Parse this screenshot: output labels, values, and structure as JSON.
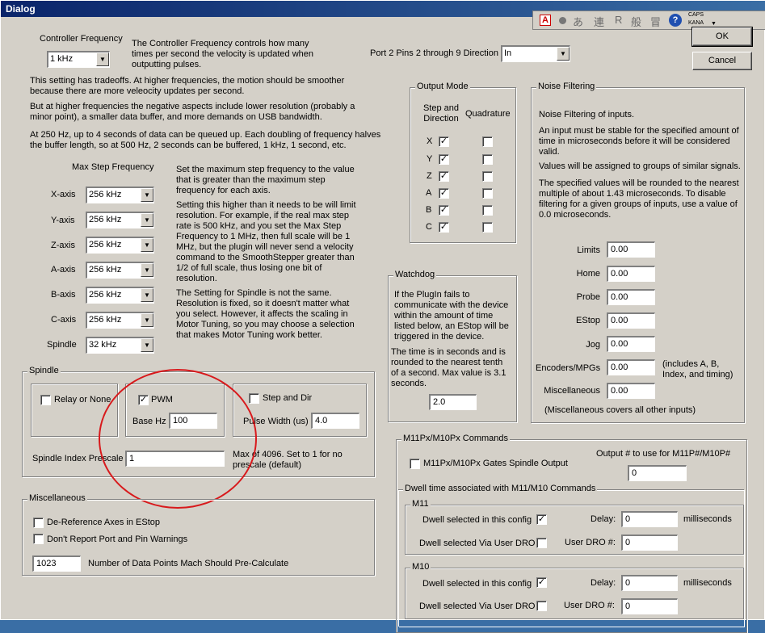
{
  "window": {
    "title": "Dialog"
  },
  "buttons": {
    "ok": "OK",
    "cancel": "Cancel"
  },
  "langbar": {
    "items": [
      "あ",
      "連",
      "R",
      "般",
      "冒"
    ],
    "caps": "CAPS",
    "kana": "KANA"
  },
  "controller": {
    "label": "Controller Frequency",
    "value": "1 kHz",
    "desc": "The Controller Frequency controls how many times per second the velocity is updated when outputting pulses.",
    "para1": "This setting has tradeoffs.  At higher frequencies, the motion should be smoother because there are more veleocity updates per second.",
    "para2": "But at higher frequencies the negative aspects include lower resolution (probably a minor point), a smaller data buffer, and more demands on USB bandwidth.",
    "para3": "At 250 Hz, up to 4 seconds of data can be queued up.  Each doubling of frequency halves the buffer length, so at 500 Hz, 2 seconds can be buffered, 1 kHz, 1 second, etc."
  },
  "port2": {
    "label": "Port 2 Pins 2 through 9 Direction",
    "value": "In"
  },
  "max_step": {
    "title": "Max Step Frequency",
    "axes": [
      {
        "label": "X-axis",
        "value": "256 kHz"
      },
      {
        "label": "Y-axis",
        "value": "256 kHz"
      },
      {
        "label": "Z-axis",
        "value": "256 kHz"
      },
      {
        "label": "A-axis",
        "value": "256 kHz"
      },
      {
        "label": "B-axis",
        "value": "256 kHz"
      },
      {
        "label": "C-axis",
        "value": "256 kHz"
      },
      {
        "label": "Spindle",
        "value": "32 kHz"
      }
    ],
    "desc1": "Set the maximum step frequency to the value that is greater than the maximum step frequency for each axis.",
    "desc2": "Setting this higher than it needs to be will limit resolution.  For example, if the real max step rate is 500 kHz, and you set the Max Step Frequency to 1 MHz, then full scale will be 1 MHz, but the plugin will never send a velocity command to the SmoothStepper greater than 1/2 of full scale, thus losing one bit of resolution.",
    "desc3": "The Setting for Spindle is not the same. Resolution is fixed, so it doesn't matter what you select.  However, it affects the scaling in Motor Tuning, so you may choose a selection that makes Motor Tuning work better."
  },
  "output_mode": {
    "title": "Output Mode",
    "col1": "Step and Direction",
    "col2": "Quadrature",
    "rows": [
      {
        "axis": "X",
        "step": true,
        "quad": false
      },
      {
        "axis": "Y",
        "step": true,
        "quad": false
      },
      {
        "axis": "Z",
        "step": true,
        "quad": false
      },
      {
        "axis": "A",
        "step": true,
        "quad": false
      },
      {
        "axis": "B",
        "step": true,
        "quad": false
      },
      {
        "axis": "C",
        "step": true,
        "quad": false
      }
    ]
  },
  "noise": {
    "title": "Noise Filtering",
    "p1": "Noise Filtering of inputs.",
    "p2": "An input must be stable for the specified amount of time in microseconds before it will be considered valid.",
    "p3": "Values will be assigned to groups of similar signals.",
    "p4": "The specified values will be rounded to the nearest multiple of about 1.43 microseconds.  To disable filtering for a given groups of inputs, use a value of 0.0 microseconds.",
    "fields": [
      {
        "label": "Limits",
        "value": "0.00"
      },
      {
        "label": "Home",
        "value": "0.00"
      },
      {
        "label": "Probe",
        "value": "0.00"
      },
      {
        "label": "EStop",
        "value": "0.00"
      },
      {
        "label": "Jog",
        "value": "0.00"
      },
      {
        "label": "Encoders/MPGs",
        "value": "0.00"
      },
      {
        "label": "Miscellaneous",
        "value": "0.00"
      }
    ],
    "encoders_note": "(includes A, B, Index, and timing)",
    "misc_note": "(Miscellaneous covers all other inputs)"
  },
  "watchdog": {
    "title": "Watchdog",
    "p1": "If the PlugIn fails to communicate with the device within the amount of time listed below, an EStop will be triggered in the device.",
    "p2": "The time is in seconds and is rounded to the nearest tenth of a second.  Max value is 3.1 seconds.",
    "value": "2.0"
  },
  "spindle": {
    "title": "Spindle",
    "relay_label": "Relay or None",
    "relay_checked": false,
    "pwm_label": "PWM",
    "pwm_checked": true,
    "base_hz_label": "Base Hz",
    "base_hz_value": "100",
    "stepdir_label": "Step and Dir",
    "stepdir_checked": false,
    "pulse_label": "Pulse Width (us)",
    "pulse_value": "4.0",
    "index_label": "Spindle Index Prescale",
    "index_value": "1",
    "index_note": "Max of 4096. Set to 1 for no prescale (default)"
  },
  "misc": {
    "title": "Miscellaneous",
    "deref_label": "De-Reference Axes in EStop",
    "noreport_label": "Don't Report Port and Pin Warnings",
    "points_value": "1023",
    "points_label": "Number of Data Points Mach Should Pre-Calculate"
  },
  "m11": {
    "title": "M11Px/M10Px Commands",
    "gates_label": "M11Px/M10Px Gates Spindle Output",
    "output_label": "Output # to use for M11P#/M10P#",
    "output_value": "0",
    "dwell_title": "Dwell time associated with M11/M10 Commands",
    "groups": [
      {
        "title": "M11",
        "dwell_label": "Dwell selected in this config",
        "dwell_checked": true,
        "delay_label": "Delay:",
        "delay_value": "0",
        "ms_label": "milliseconds",
        "userdro_label": "Dwell selected Via User DRO",
        "userdro_checked": false,
        "dro_label": "User DRO #:",
        "dro_value": "0"
      },
      {
        "title": "M10",
        "dwell_label": "Dwell selected in this config",
        "dwell_checked": true,
        "delay_label": "Delay:",
        "delay_value": "0",
        "ms_label": "milliseconds",
        "userdro_label": "Dwell selected Via User DRO",
        "userdro_checked": false,
        "dro_label": "User DRO #:",
        "dro_value": "0"
      }
    ]
  }
}
